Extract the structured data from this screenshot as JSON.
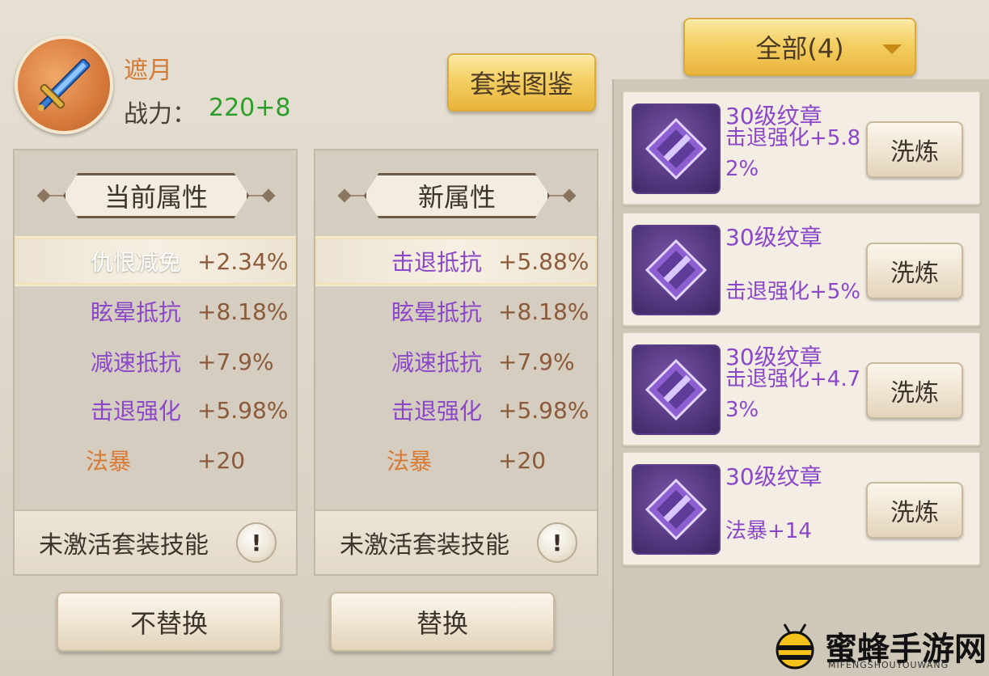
{
  "item": {
    "name": "遮月",
    "power_label": "战力：",
    "power_value": "220+8",
    "icon": "sword-icon"
  },
  "header": {
    "set_button": "套装图鉴",
    "filter": "全部(4)"
  },
  "current": {
    "title": "当前属性",
    "attrs": [
      {
        "name": "仇恨减免",
        "value": "+2.34%"
      },
      {
        "name": "眩晕抵抗",
        "value": "+8.18%"
      },
      {
        "name": "减速抵抗",
        "value": "+7.9%"
      },
      {
        "name": "击退强化",
        "value": "+5.98%"
      },
      {
        "name": "法暴",
        "value": "+20"
      }
    ],
    "skill": "未激活套装技能",
    "info_icon": "!"
  },
  "new": {
    "title": "新属性",
    "attrs": [
      {
        "name": "击退抵抗",
        "value": "+5.88%"
      },
      {
        "name": "眩晕抵抗",
        "value": "+8.18%"
      },
      {
        "name": "减速抵抗",
        "value": "+7.9%"
      },
      {
        "name": "击退强化",
        "value": "+5.98%"
      },
      {
        "name": "法暴",
        "value": "+20"
      }
    ],
    "skill": "未激活套装技能",
    "info_icon": "!"
  },
  "actions": {
    "no_replace": "不替换",
    "replace": "替换"
  },
  "emblems": [
    {
      "title": "30级纹章",
      "attr": "击退强化+5.82%",
      "button": "洗炼"
    },
    {
      "title": "30级纹章",
      "attr": "击退强化+5%",
      "button": "洗炼"
    },
    {
      "title": "30级纹章",
      "attr": "击退强化+4.73%",
      "button": "洗炼"
    },
    {
      "title": "30级纹章",
      "attr": "法暴+14",
      "button": "洗炼"
    }
  ],
  "watermark": {
    "text": "蜜蜂手游网",
    "sub": "MIFENGSHOUYOUWANG"
  },
  "colors": {
    "gold": "#f4cf63",
    "purple": "#8a47c9",
    "green": "#2e9e2a",
    "orange": "#d87a34"
  }
}
